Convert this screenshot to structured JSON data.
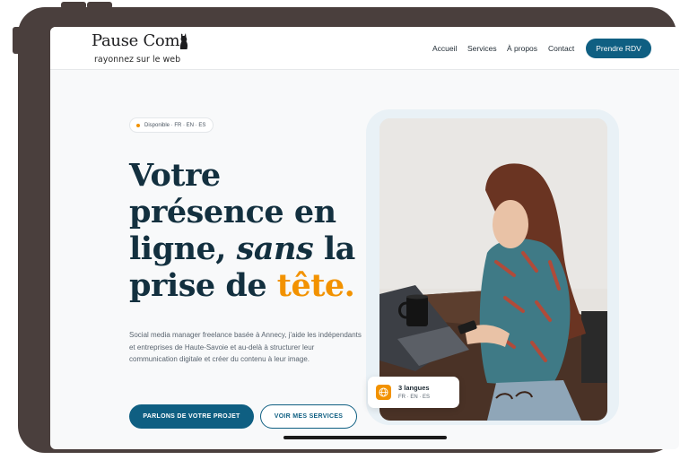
{
  "header": {
    "logo_text": "Pause Com'",
    "tagline": "rayonnez sur le web",
    "nav": [
      "Accueil",
      "Services",
      "À propos",
      "Contact"
    ],
    "cta_label": "Prendre RDV"
  },
  "hero": {
    "badge": "Disponible · FR · EN · ES",
    "headline": {
      "line1": "Votre",
      "line2": "présence en",
      "line3_start": "ligne, ",
      "line3_em": "sans",
      "line3_end": " la",
      "line4_start": "prise de ",
      "line4_accent": "tête."
    },
    "description": "Social media manager freelance basée à Annecy, j'aide les indépendants et entreprises de Haute-Savoie et au-delà à structurer leur communication digitale et créer du contenu à leur image.",
    "primary_cta": "PARLONS DE VOTRE PROJET",
    "secondary_cta": "VOIR MES SERVICES"
  },
  "lang_card": {
    "title": "3 langues",
    "languages": "FR · EN · ES",
    "icon": "globe-icon"
  },
  "colors": {
    "brand_blue": "#0f5f82",
    "accent_orange": "#f29200",
    "heading_navy": "#13303f",
    "device_frame": "#4a3f3d"
  }
}
